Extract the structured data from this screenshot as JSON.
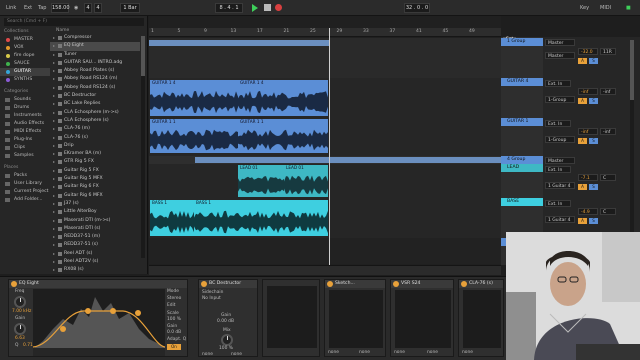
{
  "topbar": {
    "link": "Link",
    "ext": "Ext",
    "tap": "Tap",
    "tempo": "158.00",
    "sig_num": "4",
    "sig_den": "4",
    "quantize": "1 Bar",
    "position": "8 . 4 . 1",
    "loop_len": "32 . 0 . 0",
    "key": "Key",
    "midi": "MIDI"
  },
  "browser": {
    "search_placeholder": "Search (Cmd + F)",
    "collections_label": "Collections",
    "collections": [
      {
        "label": "MASTER",
        "color": "#e14a4a"
      },
      {
        "label": "VOX",
        "color": "#e39a2c"
      },
      {
        "label": "fire dope",
        "color": "#d6c94a"
      },
      {
        "label": "SAUCE",
        "color": "#3fb34d"
      },
      {
        "label": "GUITAR",
        "color": "#36a6d8"
      },
      {
        "label": "SYNTHS",
        "color": "#8b5bd6"
      }
    ],
    "categories_label": "Categories",
    "categories": [
      "Sounds",
      "Drums",
      "Instruments",
      "Audio Effects",
      "MIDI Effects",
      "Plug-Ins",
      "Clips",
      "Samples"
    ],
    "places_label": "Places",
    "places": [
      "Packs",
      "User Library",
      "Current Project",
      "Add Folder..."
    ],
    "name_col": "Name",
    "items": [
      "Compressor",
      "EQ Eight",
      "Tuner",
      "GUITAR SAU... INTRO.adg",
      "Abbey Road Plates (s)",
      "Abbey Road RS124 (m)",
      "Abbey Road RS124 (s)",
      "BC Destructor",
      "BC Lake Replies",
      "CLA Echosphere (m->s)",
      "CLA Echosphere (s)",
      "CLA-76 (m)",
      "CLA-76 (s)",
      "Drip",
      "EKramer BA (m)",
      "GTR Rig 5 FX",
      "Guitar Rig 5 FX",
      "Guitar Rig 5 MFX",
      "Guitar Rig 6 FX",
      "Guitar Rig 6 MFX",
      "J37 (s)",
      "Little AlterBoy",
      "Maserati DTI (m->s)",
      "Maserati DTI (s)",
      "REDD37-51 (m)",
      "REDD37-51 (s)",
      "Reel ADT (s)",
      "Reel ADT2V (s)",
      "RX08 (s)"
    ]
  },
  "ruler": {
    "bars": [
      "1",
      "5",
      "9",
      "13",
      "17",
      "21",
      "25",
      "29",
      "33",
      "37",
      "41",
      "45",
      "49"
    ]
  },
  "tracks": [
    {
      "clip_names": [
        "GUITAR 1 4",
        "GUITAR 1 4"
      ],
      "color": "#5b8ed6"
    },
    {
      "clip_names": [
        "GUITAR 1 1",
        "GUITAR 1 1"
      ],
      "color": "#5b8ed6"
    },
    {
      "clip_names": [
        "LEAD 01",
        "LEAD 01"
      ],
      "color": "#3eb8c4"
    },
    {
      "clip_names": [
        "BASS 1",
        "BASS 1"
      ],
      "color": "#3ecfe0"
    }
  ],
  "mixer": {
    "set_label": "Set",
    "master_label": "Master",
    "rows": [
      {
        "header": "1 Group",
        "route": "Master",
        "vol": "-32.0",
        "pan": "11R"
      },
      {
        "header": "GUITAR 4",
        "route": "1-Group",
        "io": "Ext. In",
        "vol": "-inf",
        "pan": "-inf"
      },
      {
        "header": "GUITAR 1",
        "route": "1-Group",
        "io": "Ext. In",
        "vol": "-inf",
        "pan": "-inf"
      },
      {
        "header": "4 Group",
        "route": "Master",
        "vol": "",
        "pan": ""
      },
      {
        "header": "LEAD",
        "route": "1 Guitar 4",
        "io": "Ext. In",
        "vol": "-7.1",
        "pan": "C"
      },
      {
        "header": "BASE",
        "route": "1 Guitar 4",
        "io": "Ext. In",
        "vol": "-4.9",
        "pan": "C"
      },
      {
        "header": "4 guitar BUS",
        "route": "",
        "vol": "",
        "pan": ""
      }
    ],
    "buttons": {
      "a": "A",
      "s": "S"
    }
  },
  "devices": [
    {
      "name": "EQ Eight",
      "params": [
        "Freq",
        "Gain",
        "Q",
        "Mode",
        "Stereo",
        "Edit",
        "Scale",
        "Gain",
        "Adapt. Q",
        "On",
        "Gain",
        "100 %",
        "0.0 dB"
      ]
    },
    {
      "name": "BC Destructor",
      "params": [
        "Sidechain",
        "No Input",
        "Gain",
        "0.00 dB",
        "Mix",
        "100 %",
        "none",
        "none"
      ]
    },
    {
      "name": "Sketch...",
      "params": [
        "none",
        "none"
      ]
    },
    {
      "name": "VSR S24",
      "params": [
        "none",
        "none"
      ]
    },
    {
      "name": "CLA-76 (s)",
      "params": [
        "none",
        "none"
      ]
    }
  ],
  "eq_values": {
    "freq": "7.00 kHz",
    "gain": "6.63",
    "q": "0.71"
  },
  "colors": {
    "accent": "#e8a13a",
    "play": "#3ecf5a",
    "blue_clip": "#5b8ed6",
    "cyan_clip": "#3ecfe0"
  }
}
